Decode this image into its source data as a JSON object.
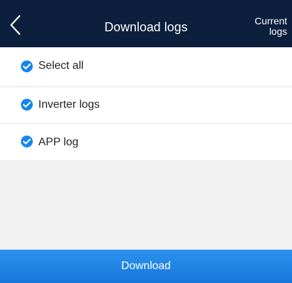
{
  "header": {
    "title": "Download logs",
    "action_label": "Current\nlogs",
    "action_line1": "Current",
    "action_line2": "logs"
  },
  "items": [
    {
      "label": "Select all",
      "checked": true
    },
    {
      "label": "Inverter logs",
      "checked": true
    },
    {
      "label": "APP log",
      "checked": true
    }
  ],
  "footer": {
    "button_label": "Download"
  },
  "colors": {
    "header_bg": "#0c1f3c",
    "accent": "#1787e8",
    "button": "#1f84e4"
  }
}
